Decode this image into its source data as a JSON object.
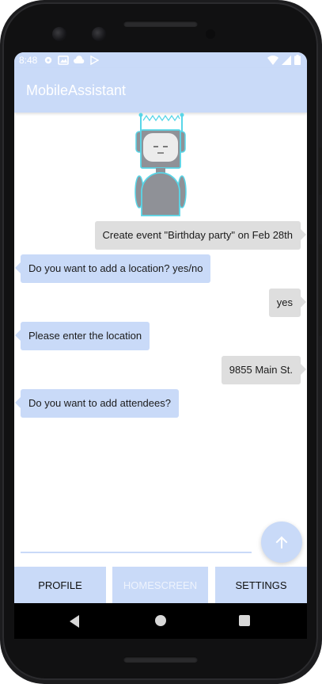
{
  "status_bar": {
    "time": "8:48",
    "left_icons": [
      "settings-icon",
      "image-icon",
      "cloud-icon",
      "play-icon"
    ],
    "right_icons": [
      "wifi-icon",
      "signal-icon",
      "battery-icon"
    ]
  },
  "app": {
    "title": "MobileAssistant"
  },
  "messages": [
    {
      "sender": "user",
      "text": "Create event \"Birthday party\" on Feb 28th"
    },
    {
      "sender": "bot",
      "text": "Do you want to add a location? yes/no"
    },
    {
      "sender": "user",
      "text": "yes"
    },
    {
      "sender": "bot",
      "text": "Please enter the location"
    },
    {
      "sender": "user",
      "text": "9855 Main St."
    },
    {
      "sender": "bot",
      "text": "Do you want to add attendees?"
    }
  ],
  "input": {
    "value": "",
    "placeholder": ""
  },
  "send_button": {
    "icon": "arrow-up-icon"
  },
  "bottom_nav": [
    {
      "label": "PROFILE",
      "active": false
    },
    {
      "label": "HOMESCREEN",
      "active": true
    },
    {
      "label": "SETTINGS",
      "active": false
    }
  ],
  "system_nav": {
    "icons": [
      "back-icon",
      "home-icon",
      "recents-icon"
    ]
  },
  "colors": {
    "accent": "#c9daf8",
    "user_bubble": "#dedede",
    "bot_bubble": "#c9daf8",
    "robot_outline": "#58d6e8",
    "robot_body": "#8f9197"
  }
}
